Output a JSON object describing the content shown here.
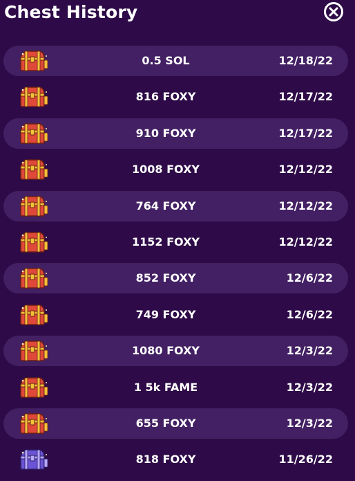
{
  "header": {
    "title": "Chest History"
  },
  "colors": {
    "background": "#2e0b48",
    "row_shaded": "#432063",
    "text": "#ffffff",
    "chest_gold_body": "#e0493a",
    "chest_gold_trim": "#f3c13a",
    "chest_purple_body": "#6b54d6",
    "chest_purple_trim": "#b6a9ff"
  },
  "rows": [
    {
      "icon": "gold-chest-icon",
      "amount": "0.5 SOL",
      "date": "12/18/22"
    },
    {
      "icon": "gold-chest-icon",
      "amount": "816 FOXY",
      "date": "12/17/22"
    },
    {
      "icon": "gold-chest-icon",
      "amount": "910 FOXY",
      "date": "12/17/22"
    },
    {
      "icon": "gold-chest-icon",
      "amount": "1008 FOXY",
      "date": "12/12/22"
    },
    {
      "icon": "gold-chest-icon",
      "amount": "764 FOXY",
      "date": "12/12/22"
    },
    {
      "icon": "gold-chest-icon",
      "amount": "1152 FOXY",
      "date": "12/12/22"
    },
    {
      "icon": "gold-chest-icon",
      "amount": "852 FOXY",
      "date": "12/6/22"
    },
    {
      "icon": "gold-chest-icon",
      "amount": "749 FOXY",
      "date": "12/6/22"
    },
    {
      "icon": "gold-chest-icon",
      "amount": "1080 FOXY",
      "date": "12/3/22"
    },
    {
      "icon": "gold-chest-icon",
      "amount": "1 5k FAME",
      "date": "12/3/22"
    },
    {
      "icon": "gold-chest-icon",
      "amount": "655 FOXY",
      "date": "12/3/22"
    },
    {
      "icon": "purple-chest-icon",
      "amount": "818 FOXY",
      "date": "11/26/22"
    }
  ]
}
